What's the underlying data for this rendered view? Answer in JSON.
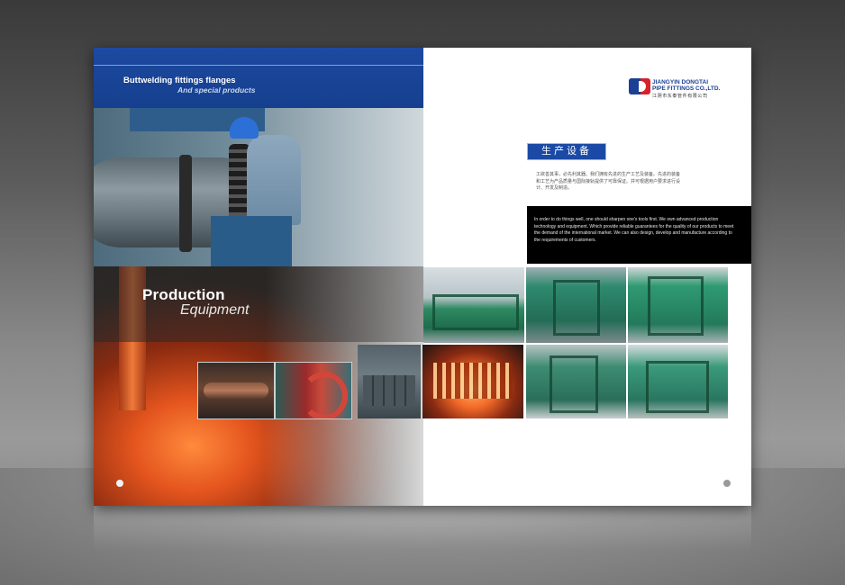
{
  "left_page": {
    "header_title": "Buttwelding fittings flanges",
    "header_subtitle": "And special products",
    "section_title": "Production",
    "section_subtitle": "Equipment"
  },
  "right_page": {
    "company_name_en_line1": "JIANGYIN DONGTAI",
    "company_name_en_line2": "PIPE FITTINGS CO.,LTD.",
    "company_name_cn": "江阴市东泰管件有限公司",
    "section_badge": "生产设备",
    "cn_paragraph": "工欲善其事，必先利其器。我们拥有先进的生产工艺及装备。先进的装备和工艺为产品质量与国际接轨提供了可靠保证。并可根据用户要求进行设计、开发及制造。",
    "en_paragraph": "In order to do things well, one should sharpen one's tools first. We own advanced production technology and equipment. Which provide reliable guarantees for the quality of our products to meet the demand of the international market. We can also design, develop and manufacture according to the requirements of customers."
  },
  "colors": {
    "brand_blue": "#1a4aa6",
    "header_blue": "#1c4aa0",
    "logo_red": "#d6222a",
    "band_black": "#000000"
  }
}
